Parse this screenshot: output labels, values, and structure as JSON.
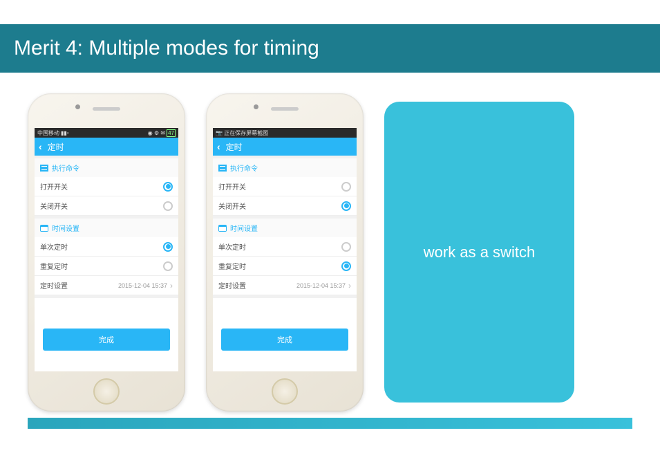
{
  "banner": {
    "title": "Merit 4: Multiple modes for timing"
  },
  "card": {
    "text": "work as a switch"
  },
  "phone1": {
    "statusbar": {
      "left": "中国移动",
      "right": "47"
    },
    "title": "定时",
    "sec_cmd": "执行命令",
    "row_on": "打开开关",
    "row_off": "关闭开关",
    "sec_time": "时间设置",
    "row_once": "单次定时",
    "row_repeat": "重复定时",
    "row_setting_label": "定时设置",
    "row_setting_value": "2015-12-04 15:37",
    "done": "完成",
    "selected": {
      "on": true,
      "off": false,
      "once": true,
      "repeat": false
    }
  },
  "phone2": {
    "statusbar": {
      "left": "📷 正在保存屏幕截图",
      "right": ""
    },
    "title": "定时",
    "sec_cmd": "执行命令",
    "row_on": "打开开关",
    "row_off": "关闭开关",
    "sec_time": "时间设置",
    "row_once": "单次定时",
    "row_repeat": "重复定时",
    "row_setting_label": "定时设置",
    "row_setting_value": "2015-12-04 15:37",
    "done": "完成",
    "selected": {
      "on": false,
      "off": true,
      "once": false,
      "repeat": true
    }
  }
}
